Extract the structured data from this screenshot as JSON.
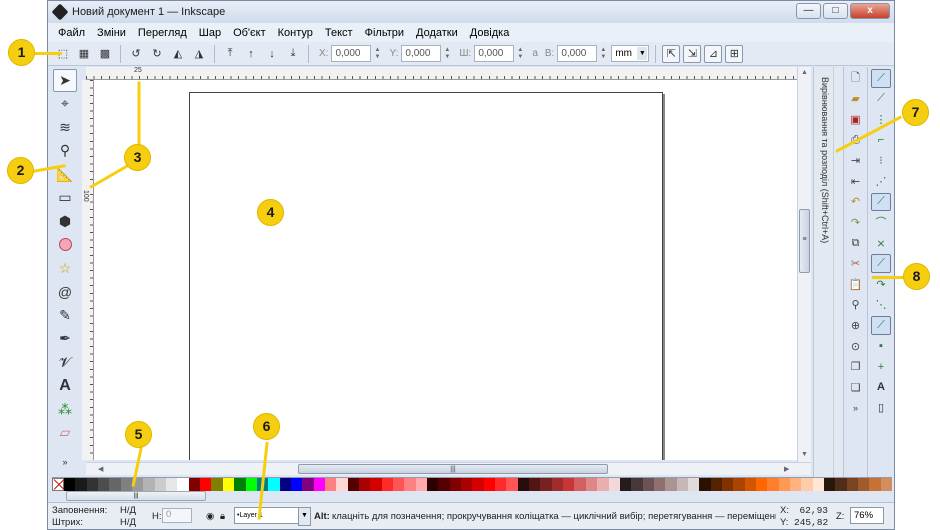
{
  "window": {
    "title": "Новий документ 1 — Inkscape",
    "minimize": "—",
    "maximize": "□",
    "close": "x"
  },
  "menu": [
    "Файл",
    "Зміни",
    "Перегляд",
    "Шар",
    "Об'єкт",
    "Контур",
    "Текст",
    "Фільтри",
    "Додатки",
    "Довідка"
  ],
  "toolcontrols": {
    "x_label": "X:",
    "x_value": "0,000",
    "y_label": "Y:",
    "y_value": "0,000",
    "w_label": "Ш:",
    "w_value": "0,000",
    "h_label": "В:",
    "h_value": "0,000",
    "lock": "a",
    "unit": "mm"
  },
  "ruler": {
    "h_label": "25",
    "v_label": "100"
  },
  "dock_label": "Вирівнювання та розподіл (Shift+Ctrl+A)",
  "status": {
    "fill_label": "Заповнення:",
    "fill_value": "Н/Д",
    "stroke_label": "Штрих:",
    "stroke_value": "Н/Д",
    "h_label": "H:",
    "h_value": "0",
    "layer": "•Layer 1",
    "hint_bold": "Alt:",
    "hint": " клацніть для позначення; прокручування коліщатка — циклічний вибір; перетягування — переміщення...",
    "x_label": "X:",
    "x_value": "62,93",
    "y_label": "Y:",
    "y_value": "245,82",
    "zoom_label": "Z:",
    "zoom_value": "76%"
  },
  "palette": [
    "#000000",
    "#1a1a1a",
    "#333333",
    "#4d4d4d",
    "#666666",
    "#808080",
    "#999999",
    "#b3b3b3",
    "#cccccc",
    "#e6e6e6",
    "#ffffff",
    "#800000",
    "#ff0000",
    "#808000",
    "#ffff00",
    "#008000",
    "#00ff00",
    "#008080",
    "#00ffff",
    "#000080",
    "#0000ff",
    "#800080",
    "#ff00ff",
    "#ff8080",
    "#ffd5d5",
    "#550000",
    "#aa0000",
    "#d40000",
    "#ff2a2a",
    "#ff5555",
    "#ff8080",
    "#ffaaaa",
    "#2b0000",
    "#550000",
    "#800000",
    "#aa0000",
    "#d40000",
    "#ff0000",
    "#ff2a2a",
    "#ff5555",
    "#280b0b",
    "#501616",
    "#782121",
    "#a02c2c",
    "#c83737",
    "#d35f5f",
    "#de8787",
    "#e9afaf",
    "#f4d7d7",
    "#241c1c",
    "#483737",
    "#6c5353",
    "#916f6f",
    "#ac9393",
    "#c8b7b7",
    "#e3dbdb",
    "#2b1100",
    "#552200",
    "#803300",
    "#aa4400",
    "#d45500",
    "#ff6600",
    "#ff7f2a",
    "#ff9955",
    "#ffb380",
    "#ffccaa",
    "#ffe6d5",
    "#28170b",
    "#502d16",
    "#784421",
    "#a05a2c",
    "#c87137",
    "#d38d5f"
  ],
  "callouts": [
    "1",
    "2",
    "3",
    "4",
    "5",
    "6",
    "7",
    "8"
  ]
}
